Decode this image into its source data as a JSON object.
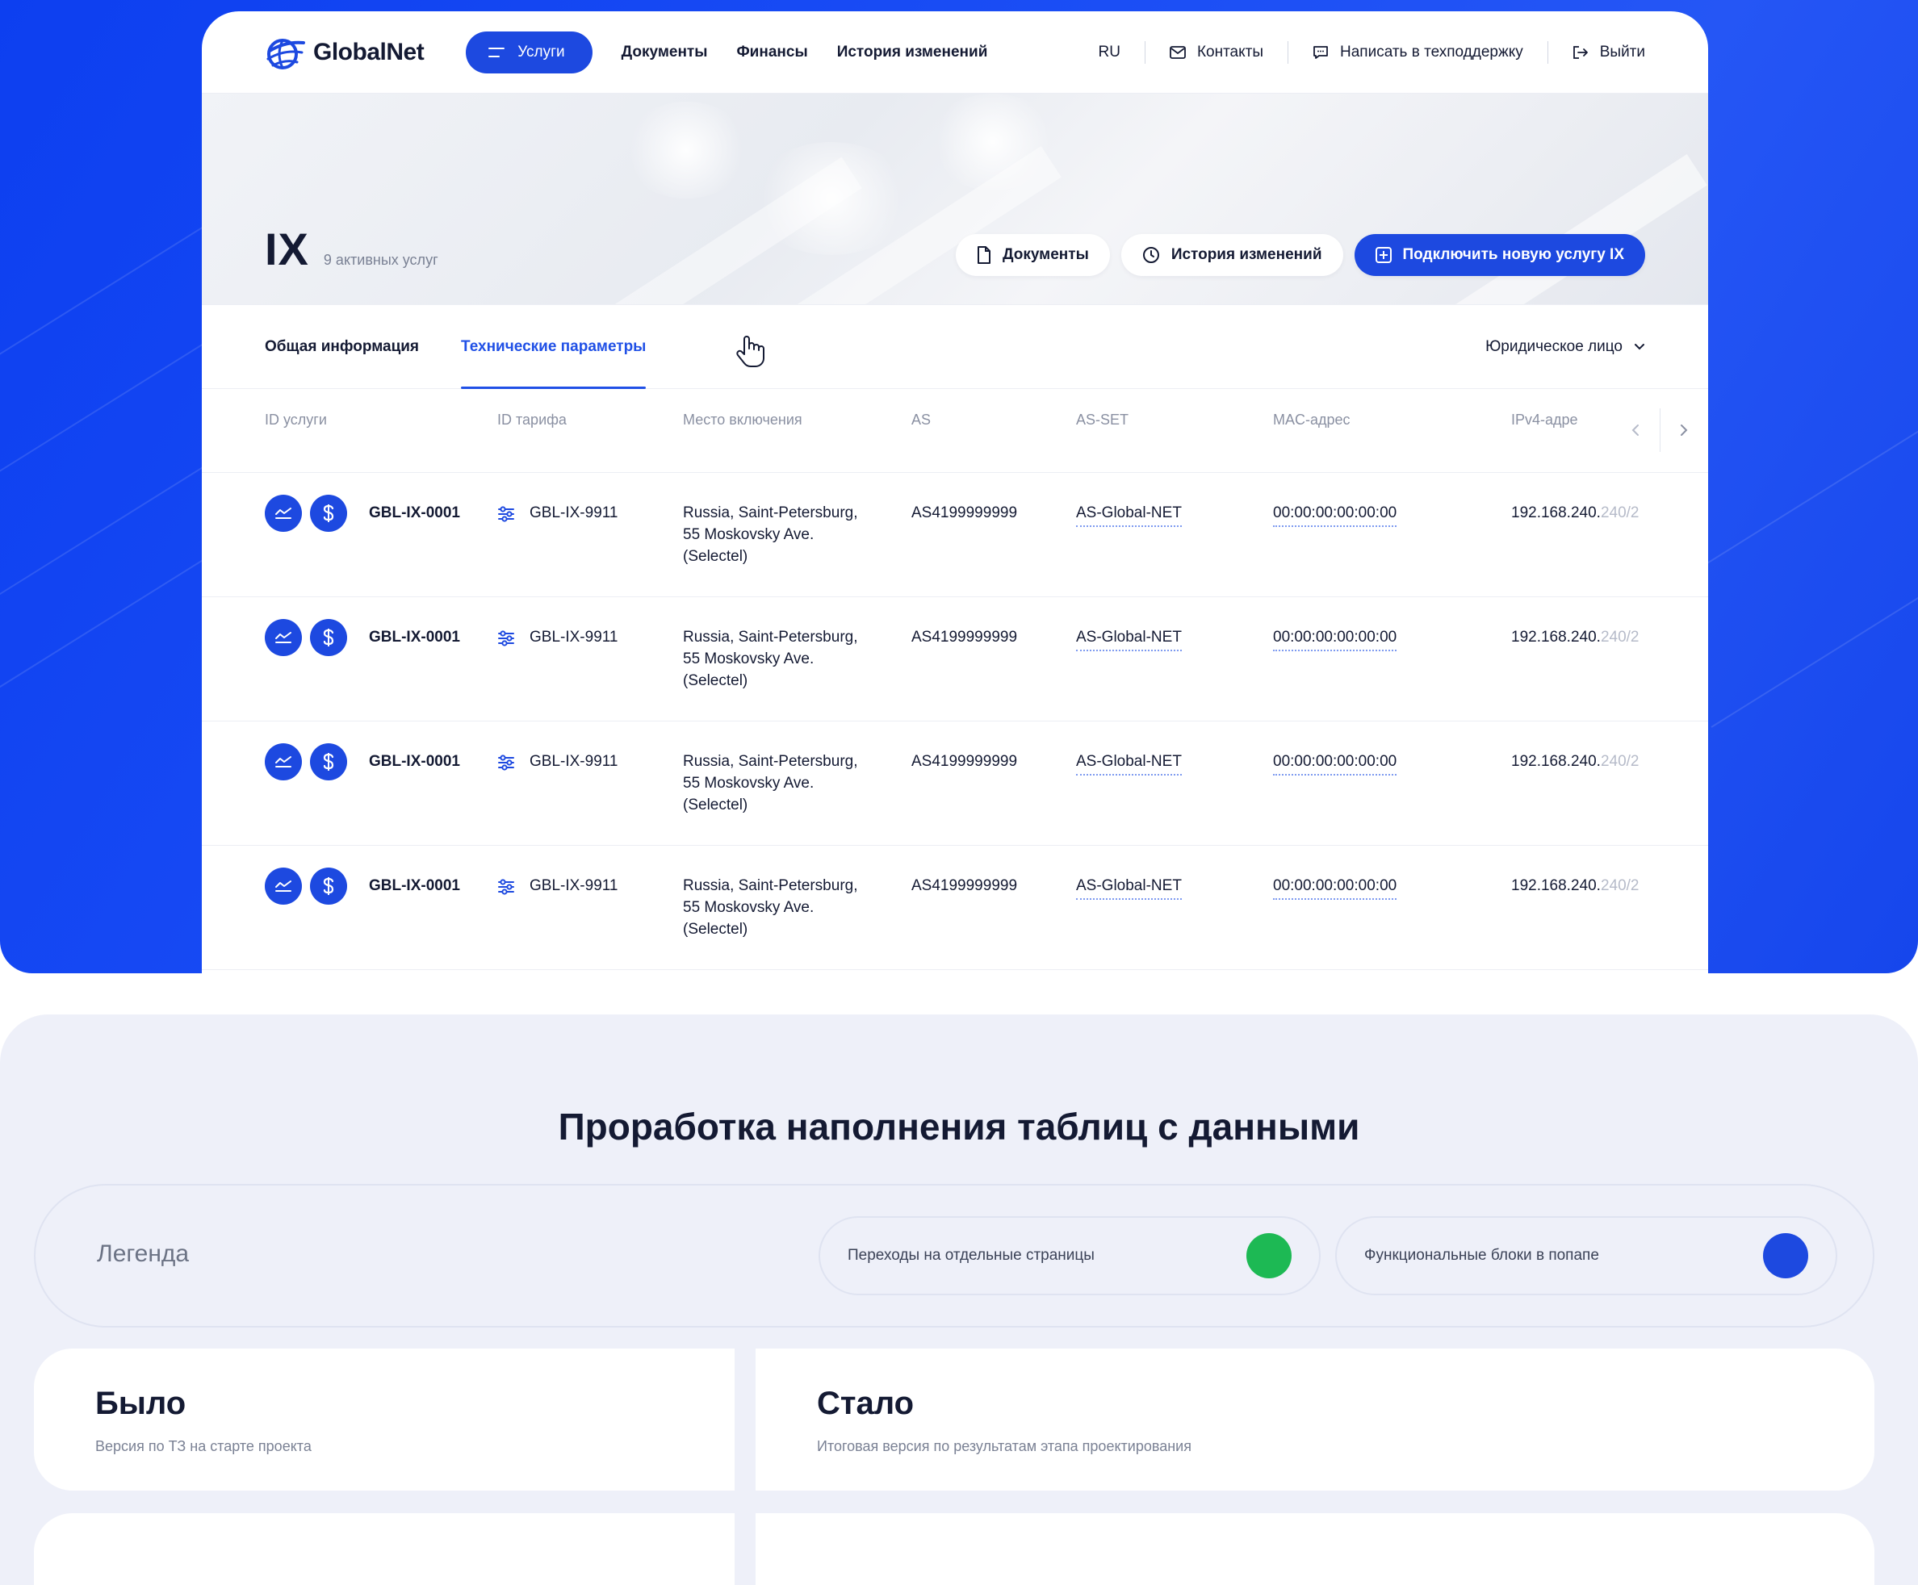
{
  "brand": {
    "name": "GlobalNet",
    "accent": "#1d49e0"
  },
  "nav": {
    "services_label": "Услуги",
    "links": [
      "Документы",
      "Финансы",
      "История изменений"
    ],
    "lang": "RU",
    "contacts": "Контакты",
    "support": "Написать в техподдержку",
    "logout": "Выйти"
  },
  "hero": {
    "title": "IX",
    "count": "9 активных услуг",
    "btn_docs": "Документы",
    "btn_history": "История изменений",
    "btn_connect": "Подключить новую услугу IX"
  },
  "tabs": {
    "general": "Общая информация",
    "technical": "Технические параметры",
    "entity": "Юридическое лицо"
  },
  "table": {
    "columns": [
      "ID услуги",
      "ID тарифа",
      "Место включения",
      "AS",
      "AS-SET",
      "MAC-адрес",
      "IPv4-адре"
    ],
    "rows": [
      {
        "id": "GBL-IX-0001",
        "tariff": "GBL-IX-9911",
        "place1": "Russia, Saint-Petersburg,",
        "place2": "55 Moskovsky Ave.",
        "place3": "(Selectel)",
        "as": "AS4199999999",
        "asset": "AS-Global-NET",
        "mac": "00:00:00:00:00:00",
        "ip_a": "192.168.240.",
        "ip_b": "240/2"
      },
      {
        "id": "GBL-IX-0001",
        "tariff": "GBL-IX-9911",
        "place1": "Russia, Saint-Petersburg,",
        "place2": "55 Moskovsky Ave.",
        "place3": "(Selectel)",
        "as": "AS4199999999",
        "asset": "AS-Global-NET",
        "mac": "00:00:00:00:00:00",
        "ip_a": "192.168.240.",
        "ip_b": "240/2"
      },
      {
        "id": "GBL-IX-0001",
        "tariff": "GBL-IX-9911",
        "place1": "Russia, Saint-Petersburg,",
        "place2": "55 Moskovsky Ave.",
        "place3": "(Selectel)",
        "as": "AS4199999999",
        "asset": "AS-Global-NET",
        "mac": "00:00:00:00:00:00",
        "ip_a": "192.168.240.",
        "ip_b": "240/2"
      },
      {
        "id": "GBL-IX-0001",
        "tariff": "GBL-IX-9911",
        "place1": "Russia, Saint-Petersburg,",
        "place2": "55 Moskovsky Ave.",
        "place3": "(Selectel)",
        "as": "AS4199999999",
        "asset": "AS-Global-NET",
        "mac": "00:00:00:00:00:00",
        "ip_a": "192.168.240.",
        "ip_b": "240/2"
      }
    ]
  },
  "lower": {
    "heading": "Проработка наполнения таблиц с данными",
    "legend_label": "Легенда",
    "legend_items": [
      {
        "label": "Переходы на отдельные страницы",
        "color": "#1db954"
      },
      {
        "label": "Функциональные блоки в попапе",
        "color": "#1d49e0"
      }
    ],
    "before_title": "Было",
    "before_sub": "Версия по ТЗ на старте проекта",
    "after_title": "Стало",
    "after_sub": "Итоговая версия по результатам этапа проектирования"
  }
}
